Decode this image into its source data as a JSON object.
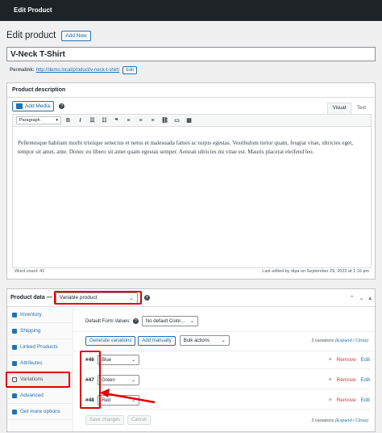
{
  "topbar": {
    "title": "Edit Product"
  },
  "header": {
    "title": "Edit product",
    "add_new": "Add New"
  },
  "product": {
    "title": "V-Neck T-Shirt"
  },
  "permalink": {
    "label": "Permalink:",
    "url": "http://demo.local/product/v-neck-t-shirt/",
    "edit": "Edit"
  },
  "description": {
    "title": "Product description",
    "add_media": "Add Media",
    "tab_visual": "Visual",
    "tab_text": "Text",
    "format": "Paragraph",
    "body": "Pellentesque habitant morbi tristique senectus et netus et malesuada fames ac turpis egestas. Vestibulum tortor quam, feugiat vitae, ultricies eget, tempor sit amet, ante. Donec eu libero sit amet quam egestas semper. Aenean ultricies mi vitae est. Mauris placerat eleifend leo.",
    "word_count": "Word count: 41",
    "last_edited": "Last edited by dipa on September 29, 2023 at 1:16 pm"
  },
  "product_data": {
    "label": "Product data —",
    "type": "Variable product",
    "nav": [
      {
        "label": "Inventory",
        "icon": "inventory-icon"
      },
      {
        "label": "Shipping",
        "icon": "shipping-icon"
      },
      {
        "label": "Linked Products",
        "icon": "link-icon"
      },
      {
        "label": "Attributes",
        "icon": "attributes-icon"
      },
      {
        "label": "Variations",
        "icon": "grid-icon"
      },
      {
        "label": "Advanced",
        "icon": "gear-icon"
      },
      {
        "label": "Get more options",
        "icon": "plugin-icon"
      }
    ],
    "default_label": "Default Form Values:",
    "default_value": "No default Color...",
    "generate": "Generate variations",
    "add_manually": "Add manually",
    "bulk": "Bulk actions",
    "count_text": "3 variations (",
    "expand": "Expand",
    "slash": " / ",
    "close": "Close",
    "close_paren": ")",
    "variations": [
      {
        "id": "#46",
        "color": "Blue"
      },
      {
        "id": "#47",
        "color": "Green"
      },
      {
        "id": "#48",
        "color": "Red"
      }
    ],
    "remove": "Remove",
    "edit": "Edit",
    "save_changes": "Save changes",
    "cancel": "Cancel"
  },
  "colors": {
    "accent": "#2271b1",
    "highlight": "#e00000"
  }
}
